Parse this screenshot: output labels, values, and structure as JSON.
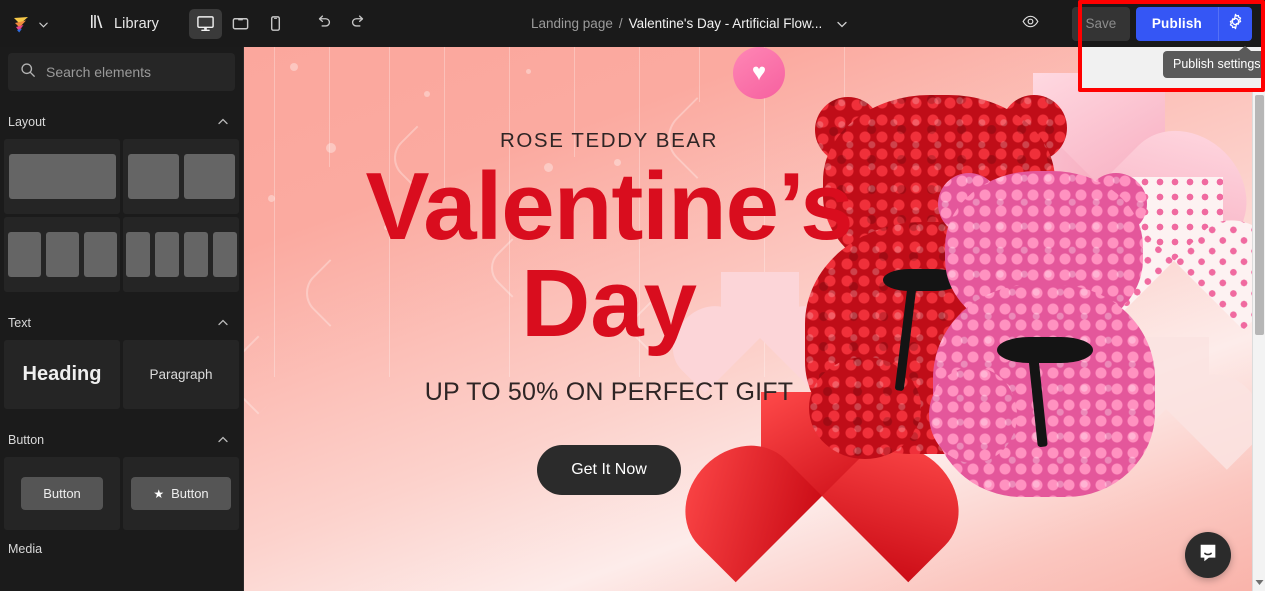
{
  "app": {
    "logo_name": "app-logo",
    "accent_blue": "#3556f5",
    "highlight_red": "#ff0000",
    "canvas_pink": "#fbaaa0"
  },
  "topbar": {
    "library_label": "Library",
    "devices": [
      {
        "name": "desktop",
        "label": "Desktop",
        "active": true
      },
      {
        "name": "tablet",
        "label": "Tablet",
        "active": false
      },
      {
        "name": "mobile",
        "label": "Mobile",
        "active": false
      }
    ],
    "undo_label": "Undo",
    "redo_label": "Redo",
    "preview_label": "Preview",
    "save_label": "Save",
    "publish_label": "Publish",
    "publish_settings_tooltip": "Publish settings"
  },
  "breadcrumb": {
    "root": "Landing page",
    "separator": "/",
    "current": "Valentine's Day - Artificial Flow..."
  },
  "sidebar": {
    "search": {
      "placeholder": "Search elements",
      "value": ""
    },
    "sections": [
      {
        "title": "Layout",
        "tiles": [
          {
            "name": "layout-one-column",
            "label": "1 column"
          },
          {
            "name": "layout-two-columns",
            "label": "2 columns"
          },
          {
            "name": "layout-three-columns",
            "label": "3 columns"
          },
          {
            "name": "layout-four-columns",
            "label": "4 columns"
          }
        ]
      },
      {
        "title": "Text",
        "tiles": [
          {
            "name": "text-heading",
            "label": "Heading"
          },
          {
            "name": "text-paragraph",
            "label": "Paragraph"
          }
        ]
      },
      {
        "title": "Button",
        "tiles": [
          {
            "name": "button-plain",
            "label": "Button"
          },
          {
            "name": "button-with-icon",
            "label": "Button"
          }
        ]
      }
    ],
    "next_section_title": "Media"
  },
  "canvas": {
    "kicker": "ROSE TEDDY BEAR",
    "headline_line1": "Valentine’s",
    "headline_line2": "Day",
    "subheadline": "UP TO 50% ON PERFECT GIFT",
    "cta_label": "Get It Now",
    "headline_color": "#d90d1e",
    "cta_bg": "#2b2b2b"
  },
  "widgets": {
    "intercom_label": "Open chat"
  }
}
